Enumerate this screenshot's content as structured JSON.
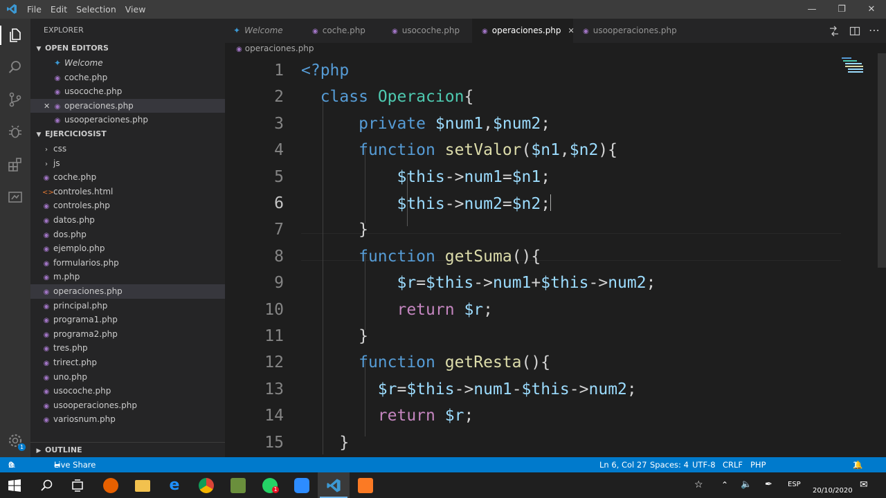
{
  "menu": [
    "File",
    "Edit",
    "Selection",
    "View"
  ],
  "sidebar": {
    "title": "EXPLORER",
    "open_editors_label": "OPEN EDITORS",
    "open_editors": [
      {
        "name": "Welcome",
        "icon": "vscode-icon",
        "italic": true
      },
      {
        "name": "coche.php",
        "icon": "php-icon"
      },
      {
        "name": "usocoche.php",
        "icon": "php-icon"
      },
      {
        "name": "operaciones.php",
        "icon": "php-icon",
        "selected": true
      },
      {
        "name": "usooperaciones.php",
        "icon": "php-icon"
      }
    ],
    "folder_label": "EJERCICIOSIST",
    "folders": [
      "css",
      "js"
    ],
    "files": [
      "coche.php",
      "controles.html",
      "controles.php",
      "datos.php",
      "dos.php",
      "ejemplo.php",
      "formularios.php",
      "m.php",
      "operaciones.php",
      "principal.php",
      "programa1.php",
      "programa2.php",
      "tres.php",
      "trirect.php",
      "uno.php",
      "usocoche.php",
      "usooperaciones.php",
      "variosnum.php"
    ],
    "outline_label": "OUTLINE"
  },
  "tabs": [
    {
      "name": "Welcome",
      "icon": "vscode-icon"
    },
    {
      "name": "coche.php",
      "icon": "php-icon"
    },
    {
      "name": "usocoche.php",
      "icon": "php-icon"
    },
    {
      "name": "operaciones.php",
      "icon": "php-icon",
      "active": true
    },
    {
      "name": "usooperaciones.php",
      "icon": "php-icon"
    }
  ],
  "breadcrumb": "operaciones.php",
  "code": {
    "current_line": 6,
    "lines": [
      "1",
      "2",
      "3",
      "4",
      "5",
      "6",
      "7",
      "8",
      "9",
      "10",
      "11",
      "12",
      "13",
      "14",
      "15"
    ]
  },
  "status": {
    "errors": "0",
    "warnings": "0",
    "live_share": "Live Share",
    "position": "Ln 6, Col 27",
    "spaces": "Spaces: 4",
    "encoding": "UTF-8",
    "eol": "CRLF",
    "language": "PHP",
    "notifications": "1"
  },
  "taskbar": {
    "language": "ESP",
    "date": "20/10/2020"
  },
  "colors": {
    "accent": "#007acc",
    "php": "#a074c4",
    "keyword": "#569cd6",
    "class": "#4ec9b0",
    "function": "#dcdcaa",
    "variable": "#9cdcfe"
  }
}
